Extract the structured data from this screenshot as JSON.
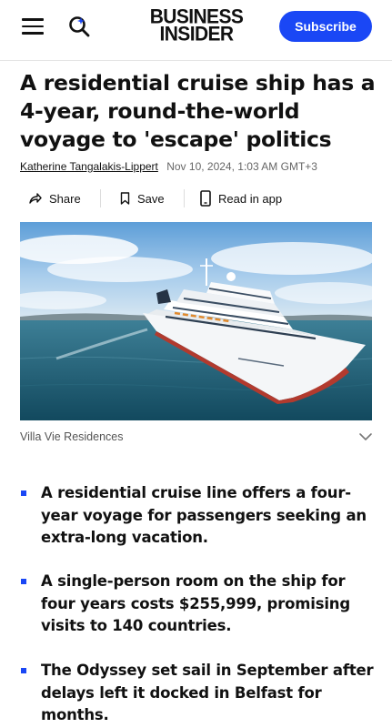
{
  "header": {
    "logo_line1": "BUSINESS",
    "logo_line2": "INSIDER",
    "subscribe_label": "Subscribe",
    "accent_color": "#1a47f5"
  },
  "article": {
    "title": "A residential cruise ship has a 4-year, round-the-world voyage to 'escape' politics",
    "author": "Katherine Tangalakis-Lippert",
    "timestamp": "Nov 10, 2024, 1:03 AM GMT+3",
    "actions": {
      "share_label": "Share",
      "save_label": "Save",
      "read_in_app_label": "Read in app"
    },
    "image_caption": "Villa Vie Residences",
    "bullets": [
      "A residential cruise line offers a four-year voyage for passengers seeking an extra-long vacation.",
      "A single-person room on the ship for four years costs $255,999, promising visits to 140 countries.",
      "The Odyssey set sail in September after delays left it docked in Belfast for months."
    ]
  },
  "icons": [
    "menu-icon",
    "search-icon",
    "share-icon",
    "bookmark-icon",
    "phone-icon",
    "chevron-down-icon"
  ]
}
